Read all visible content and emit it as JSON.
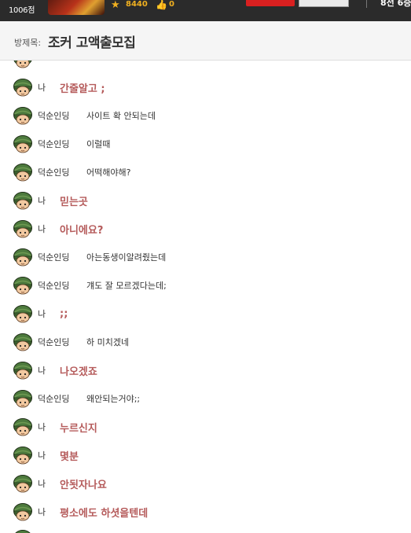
{
  "header": {
    "score": "1006점",
    "points": "8440",
    "likes": "0",
    "record": "8전 6승"
  },
  "room": {
    "label": "방제목:",
    "title": "조커 고액출모집"
  },
  "messages": [
    {
      "sender": "나",
      "text": "간줄알고 ;",
      "mine": true
    },
    {
      "sender": "덕순인딩",
      "text": "사이트 확 안되는데",
      "mine": false
    },
    {
      "sender": "덕순인딩",
      "text": "이럴때",
      "mine": false
    },
    {
      "sender": "덕순인딩",
      "text": "어떡해야해?",
      "mine": false
    },
    {
      "sender": "나",
      "text": "믿는곳",
      "mine": true
    },
    {
      "sender": "나",
      "text": "아니에요?",
      "mine": true
    },
    {
      "sender": "덕순인딩",
      "text": "아는동생이알려줬는데",
      "mine": false
    },
    {
      "sender": "덕순인딩",
      "text": "걔도 잘 모르겠다는데;",
      "mine": false
    },
    {
      "sender": "나",
      "text": ";;",
      "mine": true
    },
    {
      "sender": "덕순인딩",
      "text": "하 미치겠네",
      "mine": false
    },
    {
      "sender": "나",
      "text": "나오겠죠",
      "mine": true
    },
    {
      "sender": "덕순인딩",
      "text": "왜안되는거야;;",
      "mine": false
    },
    {
      "sender": "나",
      "text": "누르신지",
      "mine": true
    },
    {
      "sender": "나",
      "text": "몇분",
      "mine": true
    },
    {
      "sender": "나",
      "text": "안됫자나요",
      "mine": true
    },
    {
      "sender": "나",
      "text": "평소에도 하셧을텐데",
      "mine": true
    }
  ],
  "icons": {
    "avatar": "soldier-avatar-icon",
    "points": "star-icon",
    "likes": "thumbs-up-icon"
  }
}
